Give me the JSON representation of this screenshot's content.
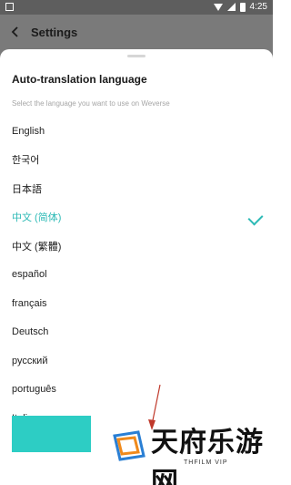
{
  "status_bar": {
    "time": "4:25"
  },
  "app_bar": {
    "title": "Settings"
  },
  "sheet": {
    "title": "Auto-translation language",
    "subtitle": "Select the language you want to use on Weverse",
    "languages": [
      {
        "label": "English",
        "selected": false
      },
      {
        "label": "한국어",
        "selected": false
      },
      {
        "label": "日本語",
        "selected": false
      },
      {
        "label": "中文 (简体)",
        "selected": true
      },
      {
        "label": "中文 (繁體)",
        "selected": false
      },
      {
        "label": "español",
        "selected": false
      },
      {
        "label": "français",
        "selected": false
      },
      {
        "label": "Deutsch",
        "selected": false
      },
      {
        "label": "русский",
        "selected": false
      },
      {
        "label": "português",
        "selected": false
      },
      {
        "label": "Italiano",
        "selected": false
      }
    ]
  },
  "watermark": {
    "text": "天府乐游网",
    "subtext": "THFILM VIP"
  },
  "colors": {
    "accent": "#2dbab6",
    "button": "#2dcdc4",
    "arrow": "#c0392b",
    "scrim": "#7a7a7a"
  },
  "icons": {
    "back": "back-arrow-icon",
    "selected": "check-icon"
  }
}
